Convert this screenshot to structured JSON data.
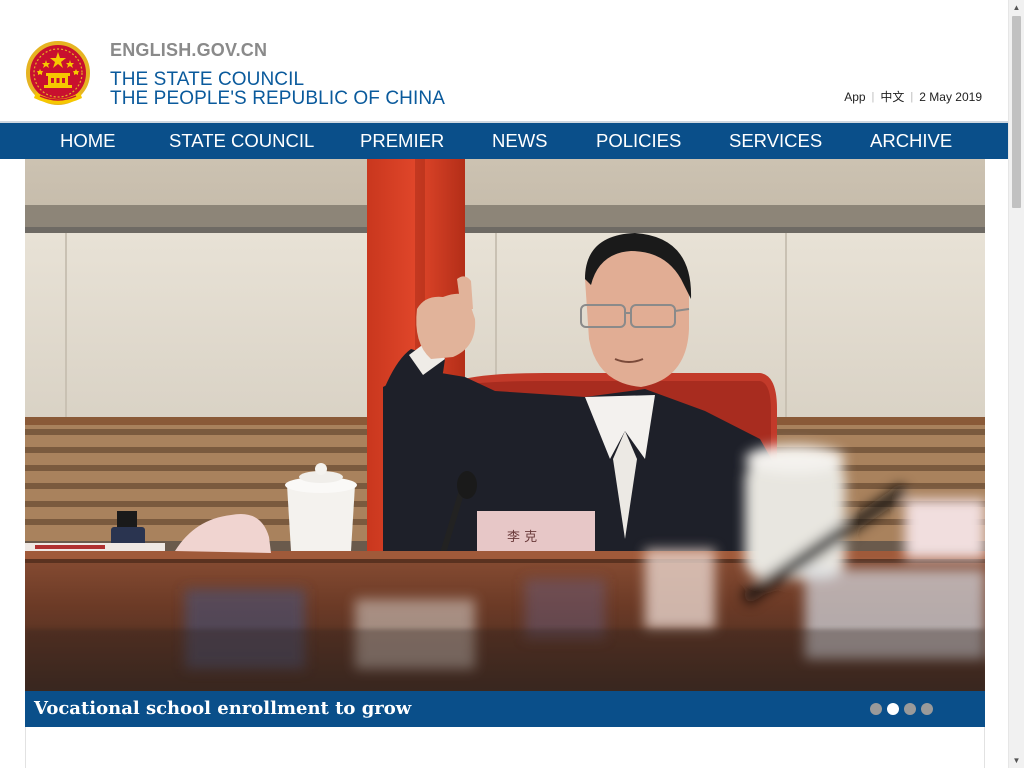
{
  "header": {
    "site_name": "ENGLISH.GOV.CN",
    "council_line1": "THE STATE COUNCIL",
    "council_line2": "THE PEOPLE'S REPUBLIC OF CHINA",
    "emblem_icon": "national-emblem-icon"
  },
  "utility": {
    "app_label": "App",
    "chinese_label": "中文",
    "date": "2 May 2019"
  },
  "nav": {
    "items": [
      {
        "label": "HOME"
      },
      {
        "label": "STATE COUNCIL"
      },
      {
        "label": "PREMIER"
      },
      {
        "label": "NEWS"
      },
      {
        "label": "POLICIES"
      },
      {
        "label": "SERVICES"
      },
      {
        "label": "ARCHIVE"
      }
    ]
  },
  "hero": {
    "caption": "Vocational school enrollment to grow",
    "slide_count": 4,
    "active_slide": 2
  },
  "colors": {
    "brand_blue": "#0a4f8a",
    "title_blue": "#0a5a9c",
    "site_name_gray": "#8a8a8a",
    "dot_inactive": "#9a9a9a",
    "dot_active": "#ffffff"
  }
}
